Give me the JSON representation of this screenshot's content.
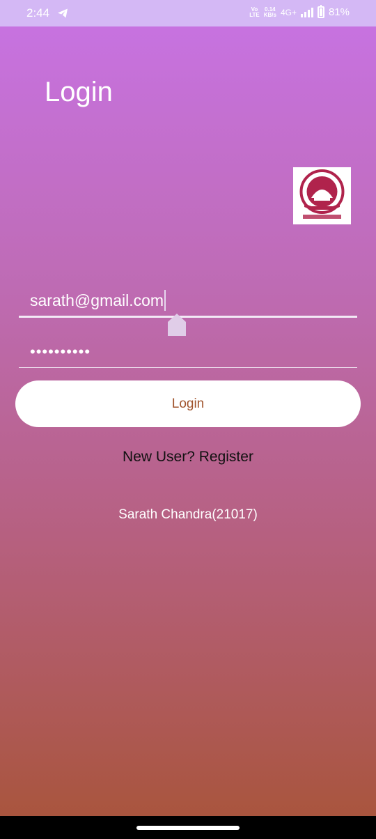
{
  "status_bar": {
    "time": "2:44",
    "volte_top": "Vo",
    "volte_bottom": "LTE",
    "speed_value": "0.14",
    "speed_unit": "KB/s",
    "network": "4G+",
    "battery": "81%"
  },
  "page": {
    "title": "Login"
  },
  "form": {
    "email_value": "sarath@gmail.com",
    "password_value": "••••••••••",
    "login_label": "Login",
    "register_label": "New User? Register"
  },
  "footer": {
    "author": "Sarath Chandra(21017)"
  },
  "colors": {
    "status_bar_bg": "#d4b8f5",
    "gradient_top": "#c772e0",
    "gradient_bottom": "#a9553e",
    "button_text": "#a0532c"
  }
}
